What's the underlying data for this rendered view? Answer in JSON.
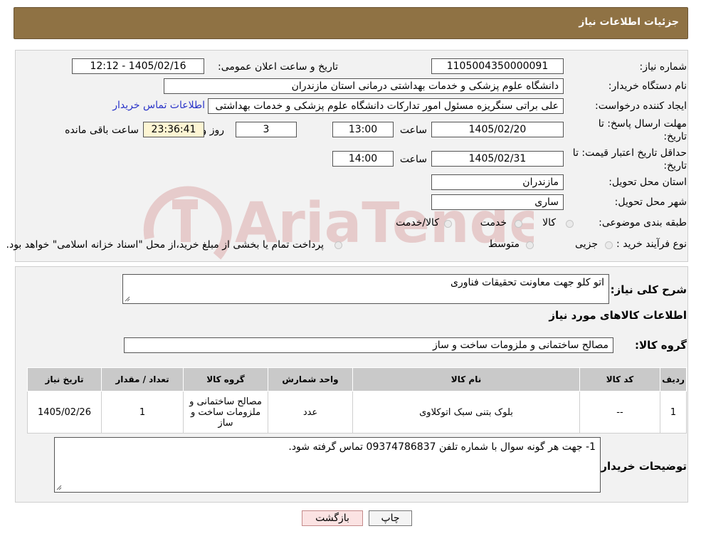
{
  "header": {
    "title": "جزئیات اطلاعات نیاز"
  },
  "fields": {
    "need_number_label": "شماره نیاز:",
    "need_number": "1105004350000091",
    "announce_label": "تاریخ و ساعت اعلان عمومی:",
    "announce_value": "1405/02/16 - 12:12",
    "buyer_org_label": "نام دستگاه خریدار:",
    "buyer_org": "دانشگاه علوم پزشکی و خدمات بهداشتی  درمانی استان مازندران",
    "creator_label": "ایجاد کننده درخواست:",
    "creator": "علی براتی سنگریزه مسئول امور تدارکات دانشگاه علوم پزشکی و خدمات بهداشتی",
    "contact_link": "اطلاعات تماس خریدار",
    "deadline_label": "مهلت ارسال پاسخ: تا تاریخ:",
    "deadline_date": "1405/02/20",
    "time_word": "ساعت",
    "deadline_time": "13:00",
    "days_value": "3",
    "days_word": "روز و",
    "remaining_time": "23:36:41",
    "remaining_word": "ساعت باقی مانده",
    "validity_label": "حداقل تاریخ اعتبار قیمت: تا تاریخ:",
    "validity_date": "1405/02/31",
    "validity_time": "14:00",
    "province_label": "استان محل تحویل:",
    "province": "مازندران",
    "city_label": "شهر محل تحویل:",
    "city": "ساری",
    "category_label": "طبقه بندی موضوعی:",
    "category_options": [
      "کالا",
      "خدمت",
      "کالا/خدمت"
    ],
    "process_label": "نوع فرآیند خرید :",
    "process_options": [
      "جزیی",
      "متوسط"
    ],
    "payment_note": "پرداخت تمام یا بخشی از مبلغ خرید،از محل \"اسناد خزانه اسلامی\" خواهد بود."
  },
  "section2": {
    "summary_label": "شرح کلی نیاز:",
    "summary": "اتو کلو جهت معاونت تحقیقات فناوری",
    "items_title": "اطلاعات کالاهای مورد نیاز",
    "group_label": "گروه کالا:",
    "group_value": "مصالح ساختمانی و ملزومات ساخت و ساز",
    "table": {
      "headers": [
        "ردیف",
        "کد کالا",
        "نام کالا",
        "واحد شمارش",
        "گروه کالا",
        "تعداد / مقدار",
        "تاریخ نیاز"
      ],
      "rows": [
        [
          "1",
          "--",
          "بلوک بتنی سبک اتوکلاوی",
          "عدد",
          "مصالح ساختمانی و ملزومات ساخت و ساز",
          "1",
          "1405/02/26"
        ]
      ]
    },
    "notes_label": "توضیحات خریدار:",
    "notes": "1- جهت هر گونه سوال با شماره تلفن 09374786837 تماس گرفته شود."
  },
  "buttons": {
    "print": "چاپ",
    "back": "بازگشت"
  },
  "watermark_text": "AriaTender.neT"
}
